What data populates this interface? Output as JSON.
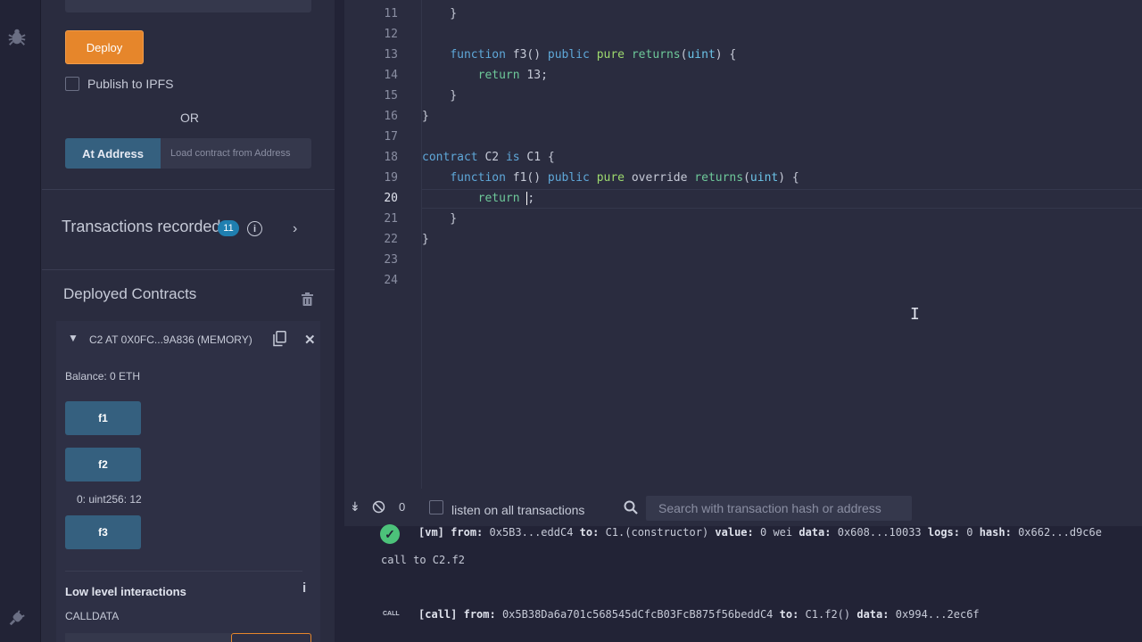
{
  "deploy": {
    "button_label": "Deploy",
    "publish_label": "Publish to IPFS",
    "or_label": "OR",
    "at_address_label": "At Address",
    "at_address_placeholder": "Load contract from Address"
  },
  "transactions": {
    "label": "Transactions recorded",
    "count": "11"
  },
  "deployed": {
    "label": "Deployed Contracts",
    "instance": {
      "title": "C2 AT 0X0FC...9A836 (MEMORY)",
      "balance": "Balance: 0 ETH",
      "functions": [
        {
          "label": "f1"
        },
        {
          "label": "f2"
        },
        {
          "label": "f3"
        }
      ],
      "result": "0: uint256: 12"
    },
    "low_level": {
      "label": "Low level interactions",
      "calldata_label": "CALLDATA"
    }
  },
  "editor": {
    "line_numbers": [
      "11",
      "12",
      "13",
      "14",
      "15",
      "16",
      "17",
      "18",
      "19",
      "20",
      "21",
      "22",
      "23",
      "24"
    ],
    "active_line": "20"
  },
  "terminal": {
    "pending_count": "0",
    "listen_label": "listen on all transactions",
    "search_placeholder": "Search with transaction hash or address",
    "logs": {
      "log1": {
        "tag": "[vm]",
        "from_label": "from:",
        "from": "0x5B3...eddC4",
        "to_label": "to:",
        "to": "C1.(constructor)",
        "value_label": "value:",
        "value": "0 wei",
        "data_label": "data:",
        "data": "0x608...10033",
        "logs_label": "logs:",
        "logs": "0",
        "hash_label": "hash:",
        "hash": "0x662...d9c6e"
      },
      "log2": "call to C2.f2",
      "log3": {
        "badge": "CALL",
        "tag": "[call]",
        "from_label": "from:",
        "from": "0x5B38Da6a701c568545dCfcB03FcB875f56beddC4",
        "to_label": "to:",
        "to": "C1.f2()",
        "data_label": "data:",
        "data": "0x994...2ec6f"
      }
    }
  },
  "colors": {
    "deploy": "#e6862b",
    "primary_button": "#35607f",
    "success": "#4cc27a",
    "badge": "#1f7fb0"
  },
  "icons": [
    "bug-icon",
    "plug-icon",
    "info-icon",
    "chevron-right-icon",
    "trash-icon",
    "chevron-down-icon",
    "copy-icon",
    "close-icon",
    "double-chevron-down-icon",
    "ban-icon",
    "search-icon",
    "check-circle-icon"
  ]
}
